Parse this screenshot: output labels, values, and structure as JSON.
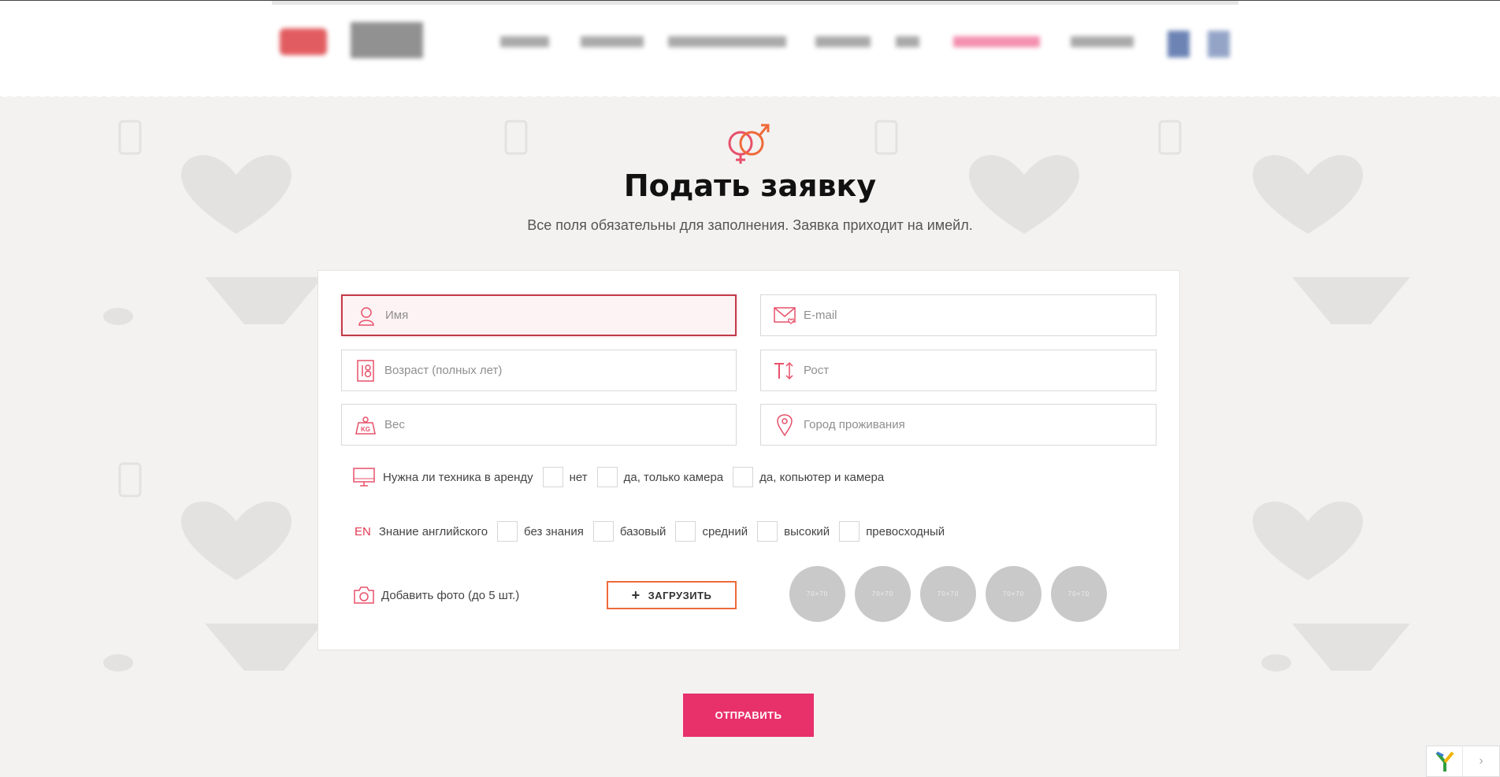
{
  "form": {
    "title": "Подать заявку",
    "subtitle": "Все поля обязательны для заполнения. Заявка приходит на имейл.",
    "fields": {
      "name_placeholder": "Имя",
      "email_placeholder": "E-mail",
      "age_placeholder": "Возраст (полных лет)",
      "height_placeholder": "Рост",
      "weight_placeholder": "Вес",
      "city_placeholder": "Город проживания"
    },
    "equipment": {
      "label": "Нужна ли техника в аренду",
      "options": [
        "нет",
        "да, только камера",
        "да, копьютер и камера"
      ]
    },
    "english": {
      "icon_text": "EN",
      "label": "Знание английского",
      "options": [
        "без знания",
        "базовый",
        "средний",
        "высокий",
        "превосходный"
      ]
    },
    "photos": {
      "label": "Добавить фото (до 5 шт.)",
      "upload_label": "ЗАГРУЗИТЬ",
      "thumb_text": "70×70"
    },
    "submit_label": "ОТПРАВИТЬ"
  },
  "icons": {
    "gender": "gender-symbols-icon",
    "name": "user-icon",
    "email": "envelope-heart-icon",
    "age": "eighteen-icon",
    "height": "height-icon",
    "weight": "weight-kg-icon",
    "city": "map-pin-icon",
    "equipment": "monitor-icon",
    "photos": "camera-icon"
  },
  "colors": {
    "accent": "#e8306a",
    "icon": "#e8506a",
    "upload_border": "#ef6a3a",
    "background": "#f3f2f1"
  }
}
